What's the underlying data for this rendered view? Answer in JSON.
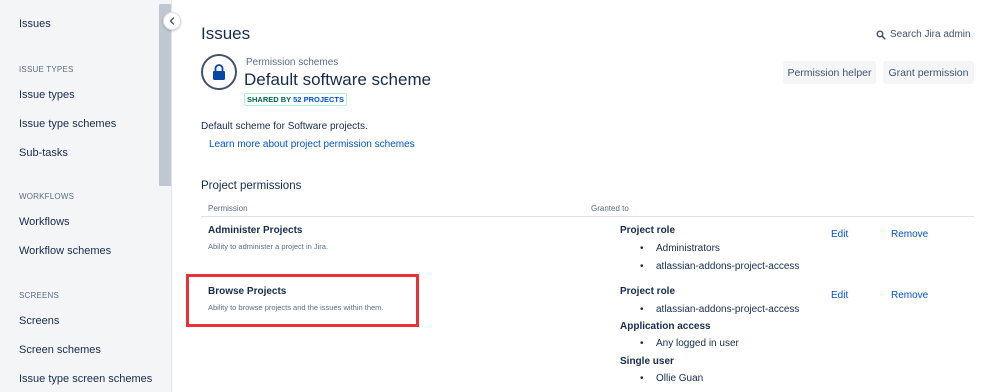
{
  "sidebar": {
    "top_item": "Issues",
    "sections": [
      {
        "heading": "ISSUE TYPES",
        "items": [
          "Issue types",
          "Issue type schemes",
          "Sub-tasks"
        ]
      },
      {
        "heading": "WORKFLOWS",
        "items": [
          "Workflows",
          "Workflow schemes"
        ]
      },
      {
        "heading": "SCREENS",
        "items": [
          "Screens",
          "Screen schemes",
          "Issue type screen schemes"
        ]
      }
    ]
  },
  "header": {
    "title": "Issues",
    "search_label": "Search Jira admin"
  },
  "scheme": {
    "breadcrumb": "Permission schemes",
    "title": "Default software scheme",
    "shared_prefix": "SHARED BY",
    "shared_count": "52 PROJECTS",
    "description": "Default scheme for Software projects.",
    "learn_link": "Learn more about project permission schemes"
  },
  "buttons": {
    "permission_helper": "Permission helper",
    "grant_permission": "Grant permission"
  },
  "permissions": {
    "section_title": "Project permissions",
    "col_permission": "Permission",
    "col_granted": "Granted to",
    "rows": [
      {
        "name": "Administer Projects",
        "description": "Ability to administer a project in Jira.",
        "grant_groups": [
          {
            "type": "Project role",
            "items": [
              "Administrators",
              "atlassian-addons-project-access"
            ]
          }
        ],
        "edit": "Edit",
        "remove": "Remove"
      },
      {
        "name": "Browse Projects",
        "description": "Ability to browse projects and the issues within them.",
        "grant_groups": [
          {
            "type": "Project role",
            "items": [
              "atlassian-addons-project-access"
            ]
          },
          {
            "type": "Application access",
            "items": [
              "Any logged in user"
            ]
          },
          {
            "type": "Single user",
            "items": [
              "Ollie Guan"
            ]
          }
        ],
        "edit": "Edit",
        "remove": "Remove"
      }
    ]
  },
  "colors": {
    "link": "#0052cc",
    "highlight": "#e8313b",
    "sidebar_bg": "#f4f5f7",
    "badge_green": "#006644"
  },
  "icons": {
    "collapse": "chevron-left-icon",
    "search": "search-icon",
    "scheme": "lock-icon"
  }
}
